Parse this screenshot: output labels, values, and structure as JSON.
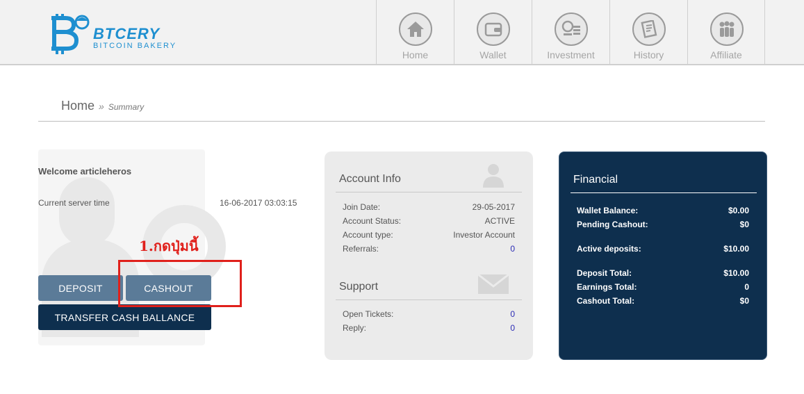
{
  "brand": {
    "name": "BTCERY",
    "tagline": "BITCOIN BAKERY",
    "color": "#1e8fd0"
  },
  "nav": [
    {
      "label": "Home",
      "icon": "home-icon"
    },
    {
      "label": "Wallet",
      "icon": "wallet-icon"
    },
    {
      "label": "Investment",
      "icon": "investment-icon"
    },
    {
      "label": "History",
      "icon": "history-icon"
    },
    {
      "label": "Affiliate",
      "icon": "affiliate-icon"
    }
  ],
  "breadcrumb": {
    "home": "Home",
    "separator": "»",
    "current": "Summary"
  },
  "welcome": {
    "text": "Welcome articleheros",
    "server_label": "Current server time",
    "server_time": "16-06-2017 03:03:15"
  },
  "annotation": {
    "text": "1.กดปุ่มนี้",
    "color": "#e0201b"
  },
  "buttons": {
    "deposit": "DEPOSIT",
    "cashout": "CASHOUT",
    "transfer": "TRANSFER CASH BALLANCE"
  },
  "account_info": {
    "title": "Account Info",
    "rows": [
      {
        "label": "Join Date:",
        "value": "29-05-2017"
      },
      {
        "label": "Account Status:",
        "value": "ACTIVE"
      },
      {
        "label": "Account type:",
        "value": "Investor Account"
      },
      {
        "label": "Referrals:",
        "value": "0"
      }
    ]
  },
  "support": {
    "title": "Support",
    "rows": [
      {
        "label": "Open Tickets:",
        "value": "0"
      },
      {
        "label": "Reply:",
        "value": "0"
      }
    ]
  },
  "financial": {
    "title": "Financial",
    "rows": [
      {
        "label": "Wallet Balance:",
        "value": "$0.00"
      },
      {
        "label": "Pending Cashout:",
        "value": "$0"
      },
      {
        "label": "Active deposits:",
        "value": "$10.00"
      },
      {
        "label": "Deposit Total:",
        "value": "$10.00"
      },
      {
        "label": "Earnings Total:",
        "value": "0"
      },
      {
        "label": "Cashout Total:",
        "value": "$0"
      }
    ]
  },
  "colors": {
    "dark_navy": "#0e2f4e",
    "steel_blue": "#5b7b98",
    "link": "#2b2bb5"
  }
}
